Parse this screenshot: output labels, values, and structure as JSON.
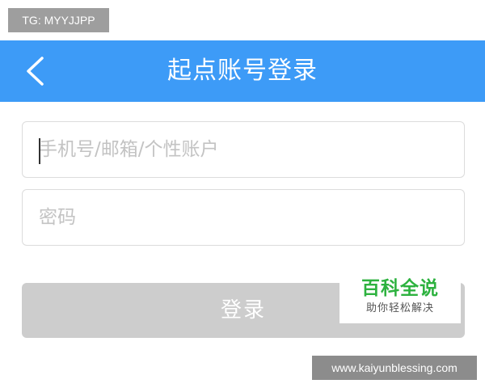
{
  "overlay": {
    "tg_label": "TG: MYYJJPP",
    "url_label": "www.kaiyunblessing.com"
  },
  "header": {
    "title": "起点账号登录",
    "back_icon": "chevron-left-icon",
    "background_color": "#3d9bf7"
  },
  "form": {
    "account": {
      "value": "",
      "placeholder": "手机号/邮箱/个性账户"
    },
    "password": {
      "value": "",
      "placeholder": "密码"
    },
    "login_label": "登录",
    "login_button_color": "#cdcdcd"
  },
  "watermark": {
    "main": "百科全说",
    "sub": "助你轻松解决",
    "color": "#2db23f"
  }
}
